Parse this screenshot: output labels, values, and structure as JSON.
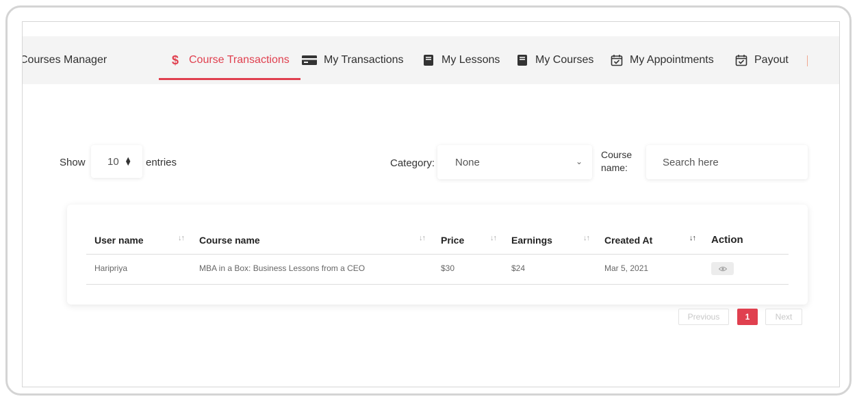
{
  "tabs": [
    {
      "label": "Courses Manager",
      "icon": "none",
      "active": false
    },
    {
      "label": "Course Transactions",
      "icon": "dollar-icon",
      "active": true
    },
    {
      "label": "My Transactions",
      "icon": "credit-card-icon",
      "active": false
    },
    {
      "label": "My Lessons",
      "icon": "book-icon",
      "active": false
    },
    {
      "label": "My Courses",
      "icon": "book-icon",
      "active": false
    },
    {
      "label": "My Appointments",
      "icon": "calendar-check-icon",
      "active": false
    },
    {
      "label": "Payout",
      "icon": "calendar-check-icon",
      "active": false
    }
  ],
  "filters": {
    "show_label": "Show",
    "entries_value": "10",
    "entries_label": "entries",
    "category_label": "Category:",
    "category_value": "None",
    "course_name_label_line1": "Course",
    "course_name_label_line2": "name:",
    "search_placeholder": "Search here"
  },
  "table": {
    "columns": [
      "User name",
      "Course name",
      "Price",
      "Earnings",
      "Created At",
      "Action"
    ],
    "rows": [
      {
        "user_name": "Haripriya",
        "course_name": "MBA in a Box: Business Lessons from a CEO",
        "price": "$30",
        "earnings": "$24",
        "created_at": "Mar 5, 2021",
        "action_icon": "eye-icon"
      }
    ]
  },
  "pagination": {
    "previous": "Previous",
    "current_page": "1",
    "next": "Next"
  },
  "colors": {
    "accent": "#e0404f",
    "tabbar_bg": "#f4f4f4"
  }
}
